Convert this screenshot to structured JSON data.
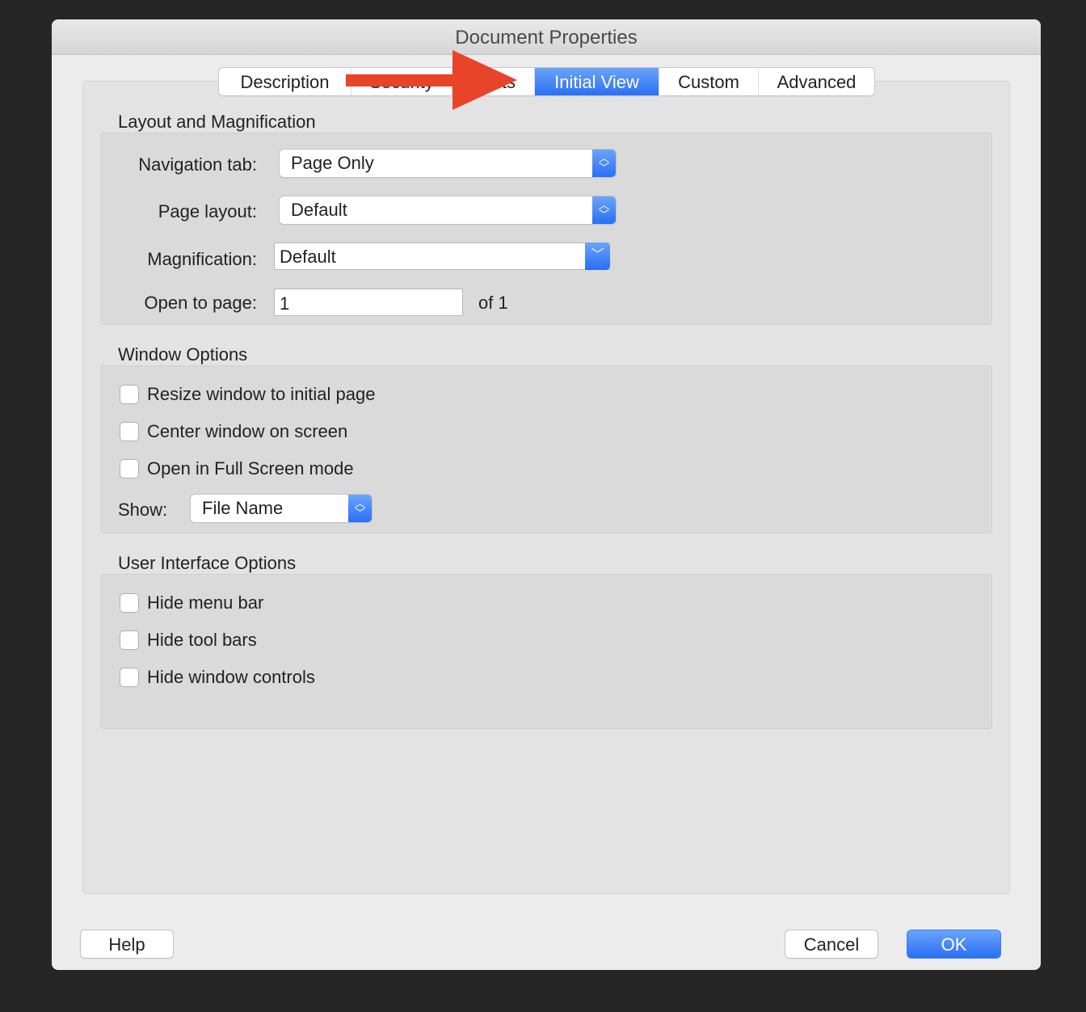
{
  "window": {
    "title": "Document Properties"
  },
  "tabs": [
    {
      "label": "Description",
      "active": false
    },
    {
      "label": "Security",
      "active": false
    },
    {
      "label": "Fonts",
      "active": false
    },
    {
      "label": "Initial View",
      "active": true
    },
    {
      "label": "Custom",
      "active": false
    },
    {
      "label": "Advanced",
      "active": false
    }
  ],
  "annotation": {
    "arrow_color": "#e8442a",
    "icon": "arrow-right-icon"
  },
  "layout": {
    "title": "Layout and Magnification",
    "navigation_tab": {
      "label": "Navigation tab:",
      "value": "Page Only"
    },
    "page_layout": {
      "label": "Page layout:",
      "value": "Default"
    },
    "magnification": {
      "label": "Magnification:",
      "value": "Default"
    },
    "open_to_page": {
      "label": "Open to page:",
      "value": "1",
      "suffix": "of 1"
    }
  },
  "window_options": {
    "title": "Window Options",
    "checkboxes": [
      {
        "label": "Resize window to initial page",
        "checked": false
      },
      {
        "label": "Center window on screen",
        "checked": false
      },
      {
        "label": "Open in Full Screen mode",
        "checked": false
      }
    ],
    "show": {
      "label": "Show:",
      "value": "File Name"
    }
  },
  "ui_options": {
    "title": "User Interface Options",
    "checkboxes": [
      {
        "label": "Hide menu bar",
        "checked": false
      },
      {
        "label": "Hide tool bars",
        "checked": false
      },
      {
        "label": "Hide window controls",
        "checked": false
      }
    ]
  },
  "buttons": {
    "help": "Help",
    "cancel": "Cancel",
    "ok": "OK"
  },
  "colors": {
    "accent": "#2a6ff5",
    "arrow": "#e8442a"
  }
}
